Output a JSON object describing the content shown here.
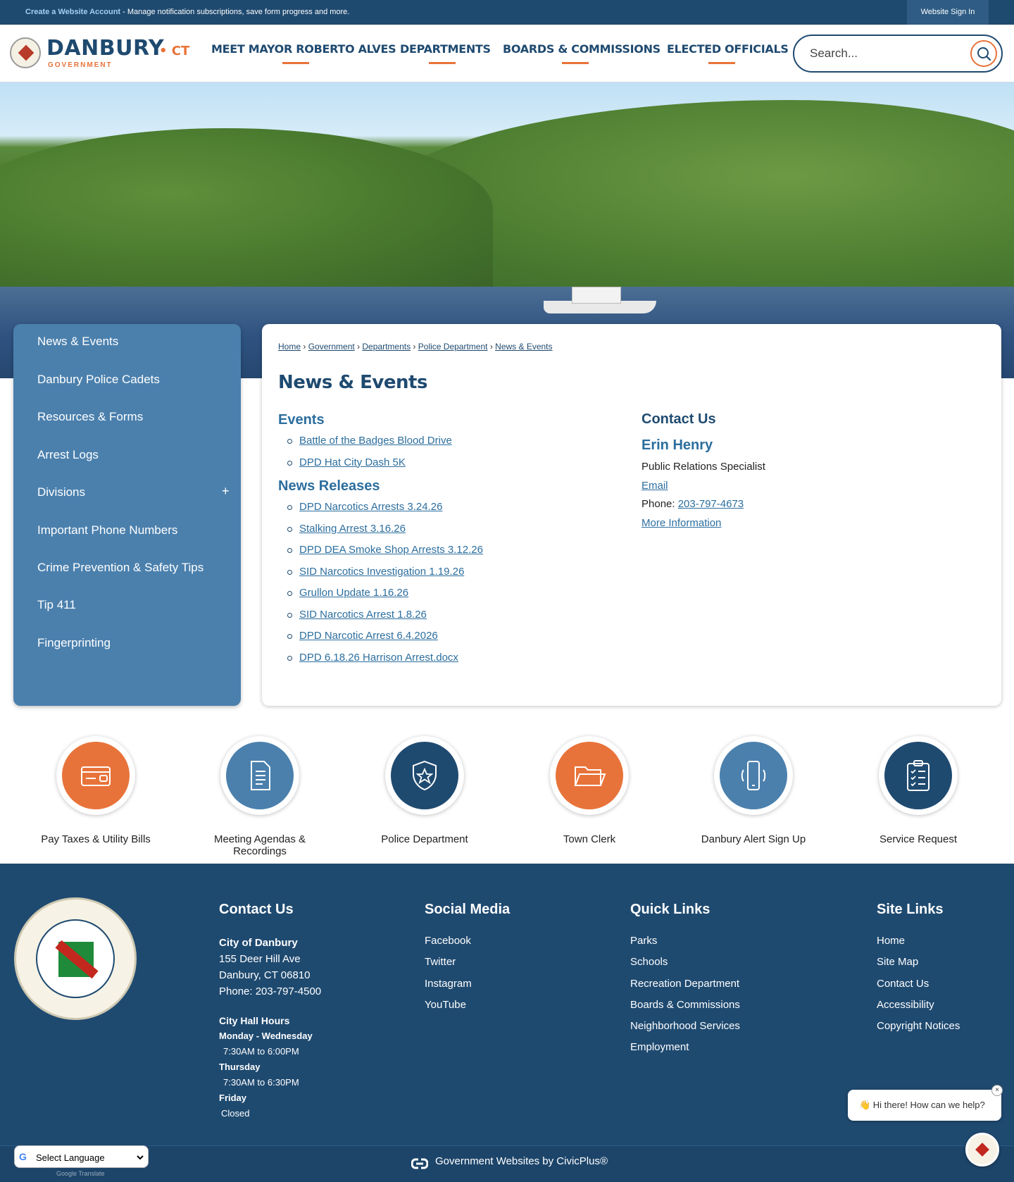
{
  "topbar": {
    "account_link": "Create a Website Account",
    "account_desc": " - Manage notification subscriptions, save form progress and more.",
    "signin": "Website Sign In"
  },
  "header": {
    "logo_name": "DANBURY",
    "logo_state": "• CT",
    "logo_sub": "GOVERNMENT",
    "nav": [
      "MEET MAYOR ROBERTO ALVES",
      "DEPARTMENTS",
      "BOARDS & COMMISSIONS",
      "ELECTED OFFICIALS"
    ],
    "search_placeholder": "Search...",
    "accent": "#e8733a",
    "brand": "#1f4a70"
  },
  "sidebar": {
    "items": [
      {
        "label": "News & Events"
      },
      {
        "label": "Danbury Police Cadets"
      },
      {
        "label": "Resources & Forms"
      },
      {
        "label": "Arrest Logs"
      },
      {
        "label": "Divisions",
        "expand": "+"
      },
      {
        "label": "Important Phone Numbers"
      },
      {
        "label": "Crime Prevention & Safety Tips"
      },
      {
        "label": "Tip 411"
      },
      {
        "label": "Fingerprinting"
      }
    ]
  },
  "main": {
    "breadcrumbs": [
      "Home",
      "Government",
      "Departments",
      "Police Department",
      "News & Events"
    ],
    "title": "News & Events",
    "events_heading": "Events",
    "events": [
      "Battle of the Badges Blood Drive",
      "DPD Hat City Dash 5K"
    ],
    "news_heading": "News Releases",
    "news": [
      "DPD Narcotics Arrests 3.24.26",
      "Stalking Arrest 3.16.26",
      "DPD DEA Smoke Shop Arrests 3.12.26",
      "SID Narcotics Investigation 1.19.26",
      "Grullon Update 1.16.26",
      "SID Narcotics Arrest 1.8.26",
      "DPD Narcotic Arrest 6.4.2026",
      "DPD 6.18.26 Harrison Arrest.docx"
    ],
    "contact": {
      "heading": "Contact Us",
      "name": "Erin Henry",
      "role": "Public Relations Specialist",
      "email": "Email",
      "phone_label": "Phone: ",
      "phone": "203-797-4673",
      "more": "More Information"
    }
  },
  "quick_links": [
    {
      "label": "Pay Taxes & Utility Bills",
      "icon": "wallet-icon",
      "color": "#e8733a"
    },
    {
      "label": "Meeting Agendas & Recordings",
      "icon": "document-icon",
      "color": "#4b80ad"
    },
    {
      "label": "Police Department",
      "icon": "police-badge-icon",
      "color": "#1f4a70"
    },
    {
      "label": "Town Clerk",
      "icon": "folder-icon",
      "color": "#e8733a"
    },
    {
      "label": "Danbury Alert Sign Up",
      "icon": "phone-alert-icon",
      "color": "#4b80ad"
    },
    {
      "label": "Service Request",
      "icon": "clipboard-icon",
      "color": "#1f4a70"
    }
  ],
  "footer": {
    "contact": {
      "heading": "Contact Us",
      "org": "City of Danbury",
      "address1": "155 Deer Hill Ave",
      "address2": "Danbury, CT 06810",
      "phone": "Phone: 203-797-4500",
      "hours_heading": "City Hall Hours",
      "hours": [
        {
          "day": "Monday - Wednesday",
          "time": "7:30AM to 6:00PM"
        },
        {
          "day": "Thursday",
          "time": "7:30AM to 6:30PM"
        },
        {
          "day": "Friday",
          "time": "Closed"
        }
      ]
    },
    "social": {
      "heading": "Social Media",
      "items": [
        "Facebook",
        "Twitter",
        "Instagram",
        "YouTube"
      ]
    },
    "quick": {
      "heading": "Quick Links",
      "items": [
        "Parks",
        "Schools",
        "Recreation Department",
        "Boards & Commissions",
        "Neighborhood Services",
        "Employment"
      ]
    },
    "site": {
      "heading": "Site Links",
      "items": [
        "Home",
        "Site Map",
        "Contact Us",
        "Accessibility",
        "Copyright Notices"
      ]
    },
    "civicplus": "Government Websites by CivicPlus®",
    "language": "Select Language",
    "powered": "Google Translate"
  },
  "chat": {
    "greeting": "👋 Hi there! How can we help?",
    "close": "×"
  }
}
